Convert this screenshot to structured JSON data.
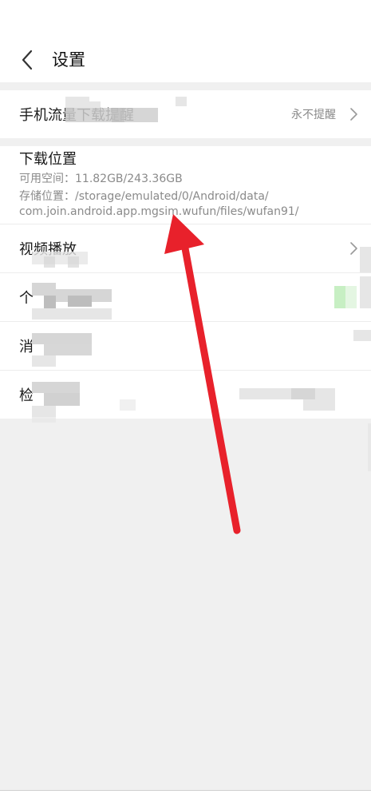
{
  "header": {
    "title": "设置"
  },
  "rows": {
    "mobile_data": {
      "label": "手机流量下载提醒",
      "value": "永不提醒"
    },
    "download": {
      "title": "下载位置",
      "space": "可用空间：11.82GB/243.36GB",
      "path_line1": "存储位置：/storage/emulated/0/Android/data/",
      "path_line2": "com.join.android.app.mgsim.wufun/files/wufan91/"
    },
    "video": {
      "label": "视频播放"
    },
    "personal": {
      "label": "个"
    },
    "message": {
      "label": "消"
    },
    "check": {
      "label": "检"
    }
  },
  "icons": {
    "back": "chevron-left-icon",
    "chevron": "chevron-right-icon"
  },
  "colors": {
    "arrow": "#e8212b",
    "accent_green": "#4cd964"
  }
}
